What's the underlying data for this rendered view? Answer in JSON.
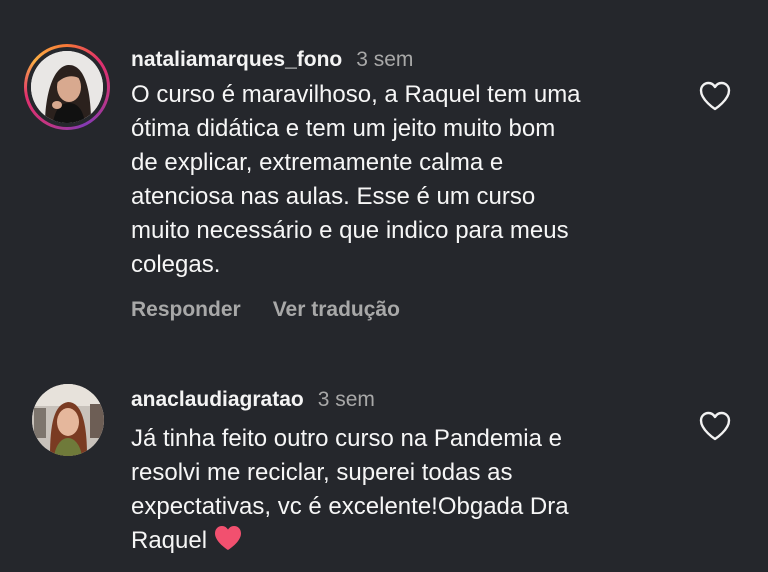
{
  "comments": [
    {
      "username": "nataliamarques_fono",
      "time": "3 sem",
      "text": "O curso é maravilhoso, a Raquel tem uma\nótima didática e tem um jeito muito bom\nde explicar, extremamente calma e\natenciosa nas aulas. Esse é um curso\nmuito necessário e que indico para meus\ncolegas.",
      "reply_label": "Responder",
      "translate_label": "Ver tradução",
      "like_icon": "heart-outline-icon"
    },
    {
      "username": "anaclaudiagratao",
      "time": "3 sem",
      "text": "Já tinha feito outro curso na Pandemia e\nresolvi me reciclar, superei todas as\nexpectativas, vc é excelente!Obgada Dra\nRaquel",
      "emoji_icon": "red-heart-emoji-icon",
      "like_icon": "heart-outline-icon"
    }
  ],
  "colors": {
    "background": "#25272c",
    "text": "#f6f6f6",
    "secondary_text": "#a8a8a8",
    "story_ring": [
      "#f77737",
      "#e1306c",
      "#c13584",
      "#833ab4"
    ],
    "emoji_heart": "#f2506f"
  }
}
